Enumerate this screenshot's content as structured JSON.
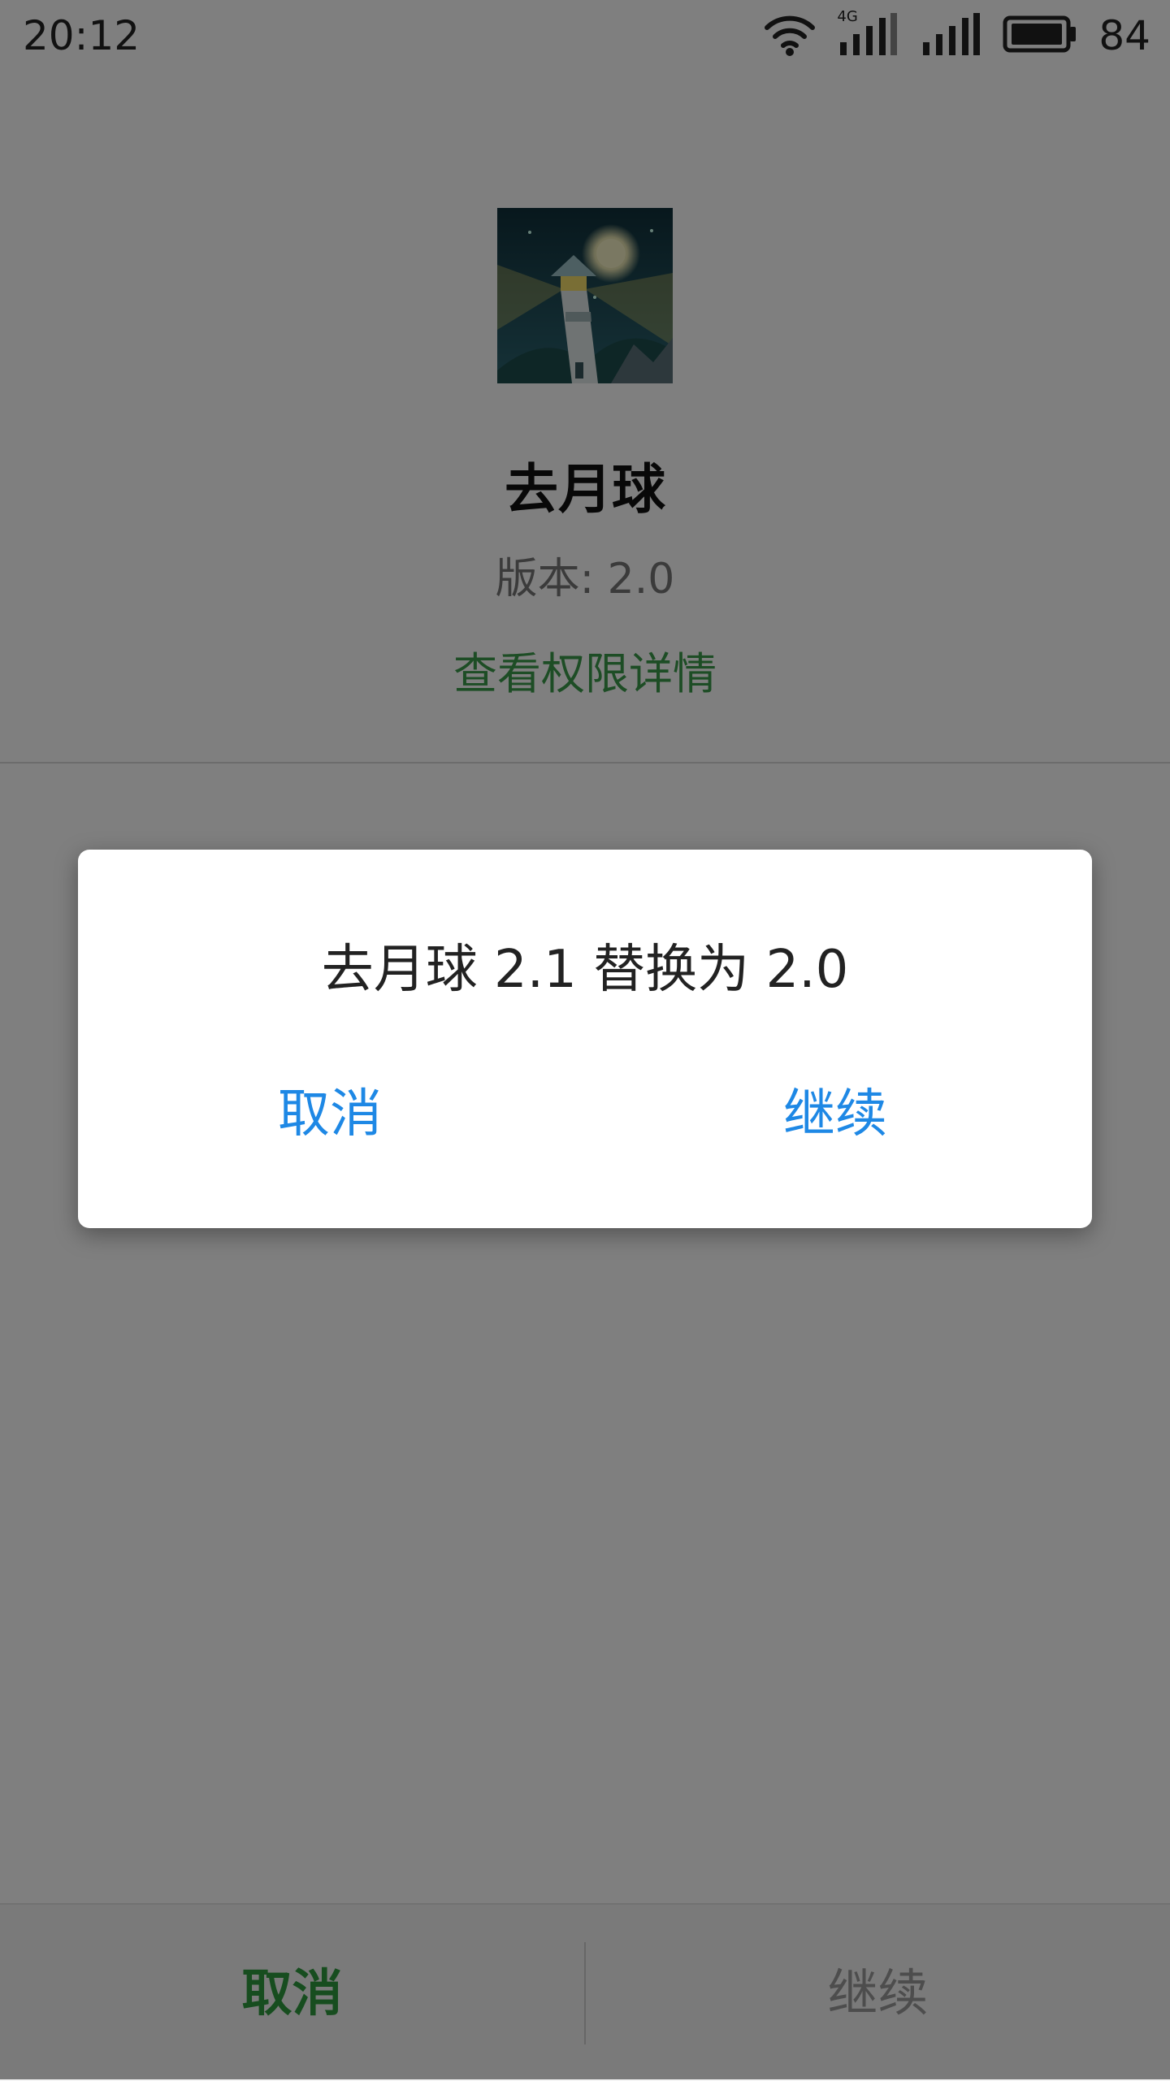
{
  "status_bar": {
    "time": "20:12",
    "network_type": "4G",
    "battery_percent": "84",
    "icons": [
      "wifi-icon",
      "signal-4g-icon",
      "signal-icon",
      "battery-icon"
    ]
  },
  "app": {
    "icon": "lighthouse-app-icon",
    "name": "去月球",
    "version_label": "版本: 2.0",
    "permissions_link": "查看权限详情"
  },
  "bottom_bar": {
    "cancel_label": "取消",
    "continue_label": "继续"
  },
  "dialog": {
    "message": "去月球 2.1 替换为 2.0",
    "cancel_label": "取消",
    "continue_label": "继续"
  },
  "colors": {
    "accent_green": "#2e9a3e",
    "dialog_blue": "#1e88e5",
    "overlay": "rgba(0,0,0,0.5)"
  }
}
